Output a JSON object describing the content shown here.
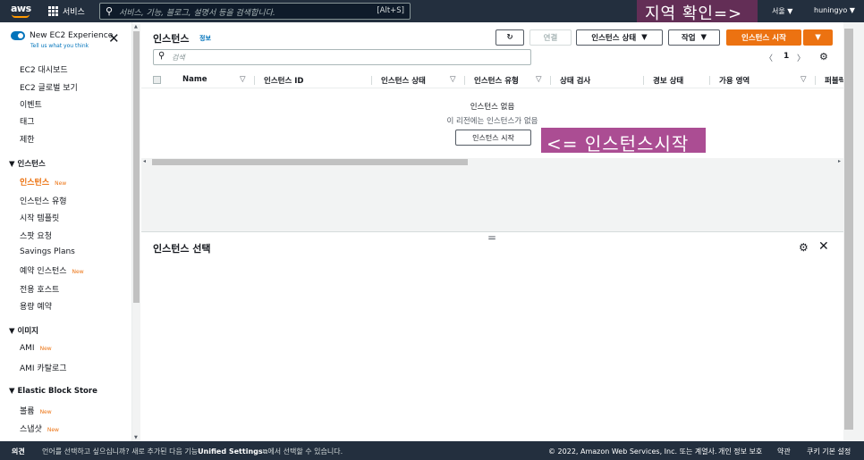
{
  "topnav": {
    "logo": "aws",
    "services_label": "서비스",
    "search_placeholder": "서비스, 기능, 블로그, 설명서 등을 검색합니다.",
    "search_shortcut": "[Alt+S]",
    "region": "서울 ▼",
    "user": "huningyo ▼"
  },
  "annotations": {
    "region_check": "지역 확인=>",
    "launch_instance": "<= 인스턴스시작"
  },
  "sidebar": {
    "experience_title": "New EC2 Experience",
    "experience_sub": "Tell us what you think",
    "new_badge": "New",
    "items": [
      {
        "label": "EC2 대시보드"
      },
      {
        "label": "EC2 글로벌 보기"
      },
      {
        "label": "이벤트"
      },
      {
        "label": "태그"
      },
      {
        "label": "제한"
      }
    ],
    "group_instances": "인스턴스",
    "instances_items": [
      {
        "label": "인스턴스"
      },
      {
        "label": "인스턴스 유형"
      },
      {
        "label": "시작 템플릿"
      },
      {
        "label": "스팟 요청"
      },
      {
        "label": "Savings Plans"
      },
      {
        "label": "예약 인스턴스"
      },
      {
        "label": "전용 호스트"
      },
      {
        "label": "용량 예약"
      }
    ],
    "group_images": "이미지",
    "images_items": [
      {
        "label": "AMI"
      },
      {
        "label": "AMI 카탈로그"
      }
    ],
    "group_ebs": "Elastic Block Store",
    "ebs_items": [
      {
        "label": "볼륨"
      },
      {
        "label": "스냅샷"
      }
    ]
  },
  "main": {
    "title": "인스턴스",
    "info": "정보",
    "connect_button": "연결",
    "state_button": "인스턴스 상태",
    "actions_button": "작업",
    "launch_button": "인스턴스 시작",
    "filter_placeholder": "검색",
    "page_number": "1",
    "columns": [
      "Name",
      "인스턴스 ID",
      "인스턴스 상태",
      "인스턴스 유형",
      "상태 검사",
      "경보 상태",
      "가용 영역",
      "퍼블릭"
    ],
    "empty_title": "인스턴스 없음",
    "empty_sub": "이 리전에는 인스턴스가 없음",
    "empty_launch_button": "인스턴스 시작",
    "split_title": "인스턴스 선택"
  },
  "footer": {
    "feedback": "의견",
    "lang_text_pre": "언어를 선택하고 싶으십니까? 새로 추가된 다음 기능",
    "lang_link": "Unified Settings",
    "lang_text_post": "에서 선택할 수 있습니다.",
    "copyright": "© 2022, Amazon Web Services, Inc. 또는 계열사.",
    "privacy": "개인 정보 보호",
    "terms": "약관",
    "cookies": "쿠키 기본 설정"
  }
}
